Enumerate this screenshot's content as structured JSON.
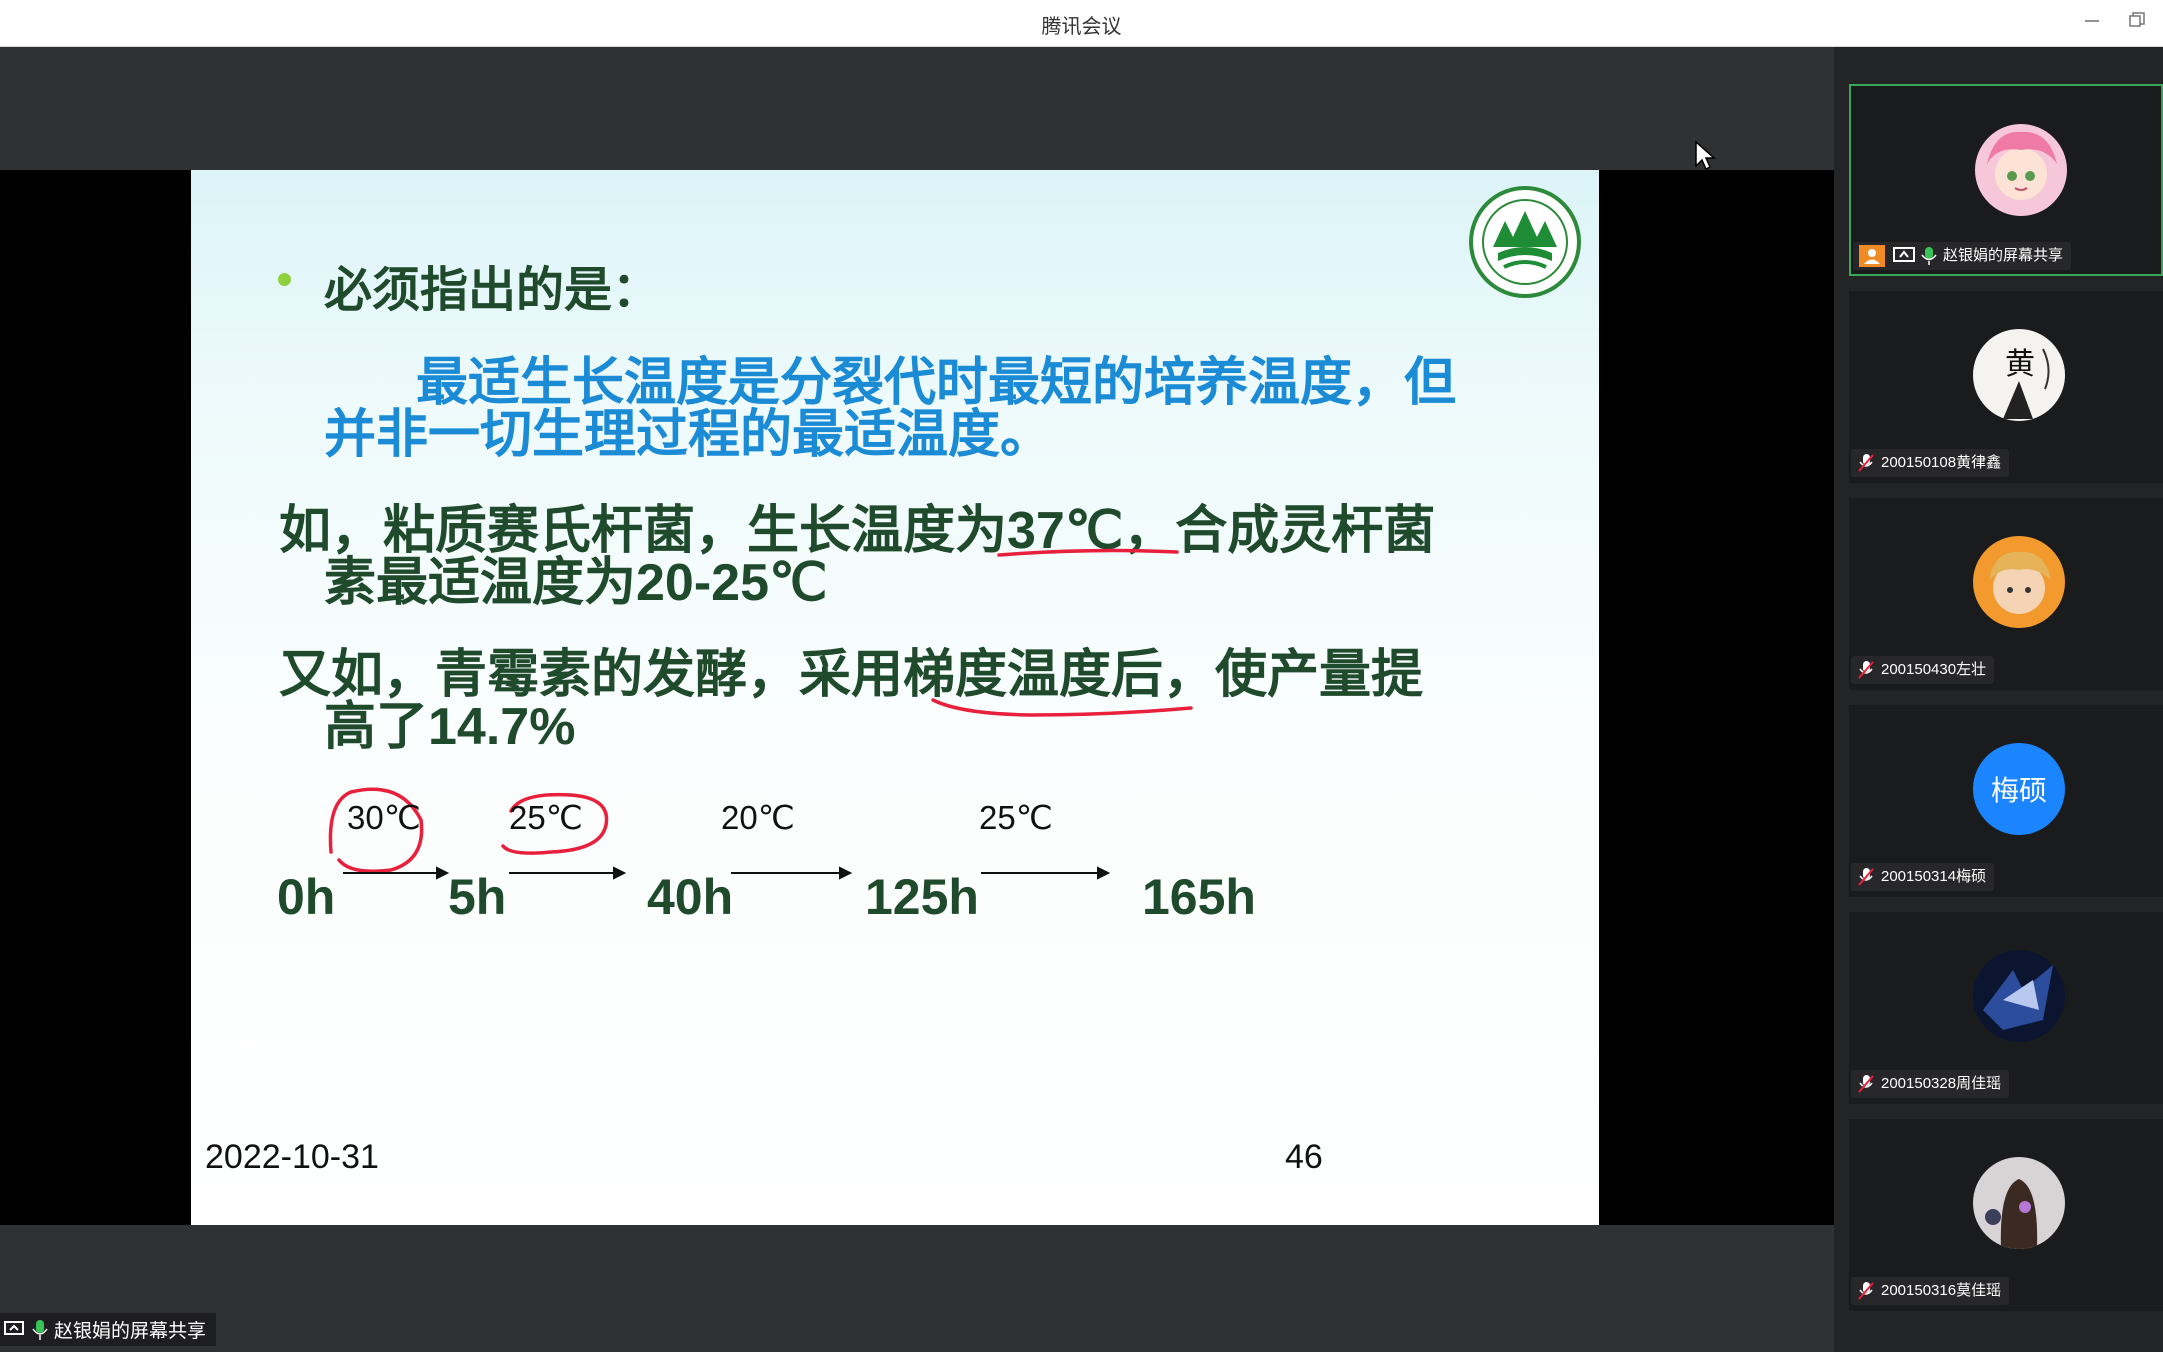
{
  "app": {
    "title": "腾讯会议",
    "minimize_icon": "minimize-icon",
    "restore_icon": "restore-icon"
  },
  "slide": {
    "bullet_heading": "必须指出的是：",
    "blue_line1": "最适生长温度是分裂代时最短的培养温度，但",
    "blue_line2": "并非一切生理过程的最适温度。",
    "para1_line1_a": "如，粘质赛氏杆菌，生长温度为",
    "para1_line1_b": "37℃",
    "para1_line1_c": "，合成灵杆菌",
    "para1_line2_a": "素最适温度为",
    "para1_line2_b": "20-25℃",
    "para2_line1": "又如，青霉素的发酵，采用梯度温度后，使产量提",
    "para2_line2_a": "高了",
    "para2_line2_b": "14.7%",
    "timeline": {
      "temps": [
        "30℃",
        "25℃",
        "20℃",
        "25℃"
      ],
      "hours": [
        "0h",
        "5h",
        "40h",
        "125h",
        "165h"
      ]
    },
    "date": "2022-10-31",
    "page_number": "46"
  },
  "participants": [
    {
      "name": "赵银娟的屏幕共享",
      "active": true,
      "avatar": "anime-pink-hair-avatar"
    },
    {
      "name": "200150108黄律鑫",
      "avatar": "ink-character-avatar"
    },
    {
      "name": "200150430左壮",
      "avatar": "cartoon-boy-avatar"
    },
    {
      "name": "200150314梅硕",
      "avatar_text": "梅硕",
      "avatar_color": "#1a85ff"
    },
    {
      "name": "200150328周佳瑶",
      "avatar": "dark-blue-abstract-avatar"
    },
    {
      "name": "200150316莫佳瑶",
      "avatar": "girl-back-flowers-avatar"
    }
  ],
  "bottom_share_label": "赵银娟的屏幕共享",
  "colors": {
    "slide_green": "#1f4a2c",
    "slide_blue": "#1b8bd6",
    "annotation_red": "#e8203c",
    "active_border": "#3aa657"
  }
}
